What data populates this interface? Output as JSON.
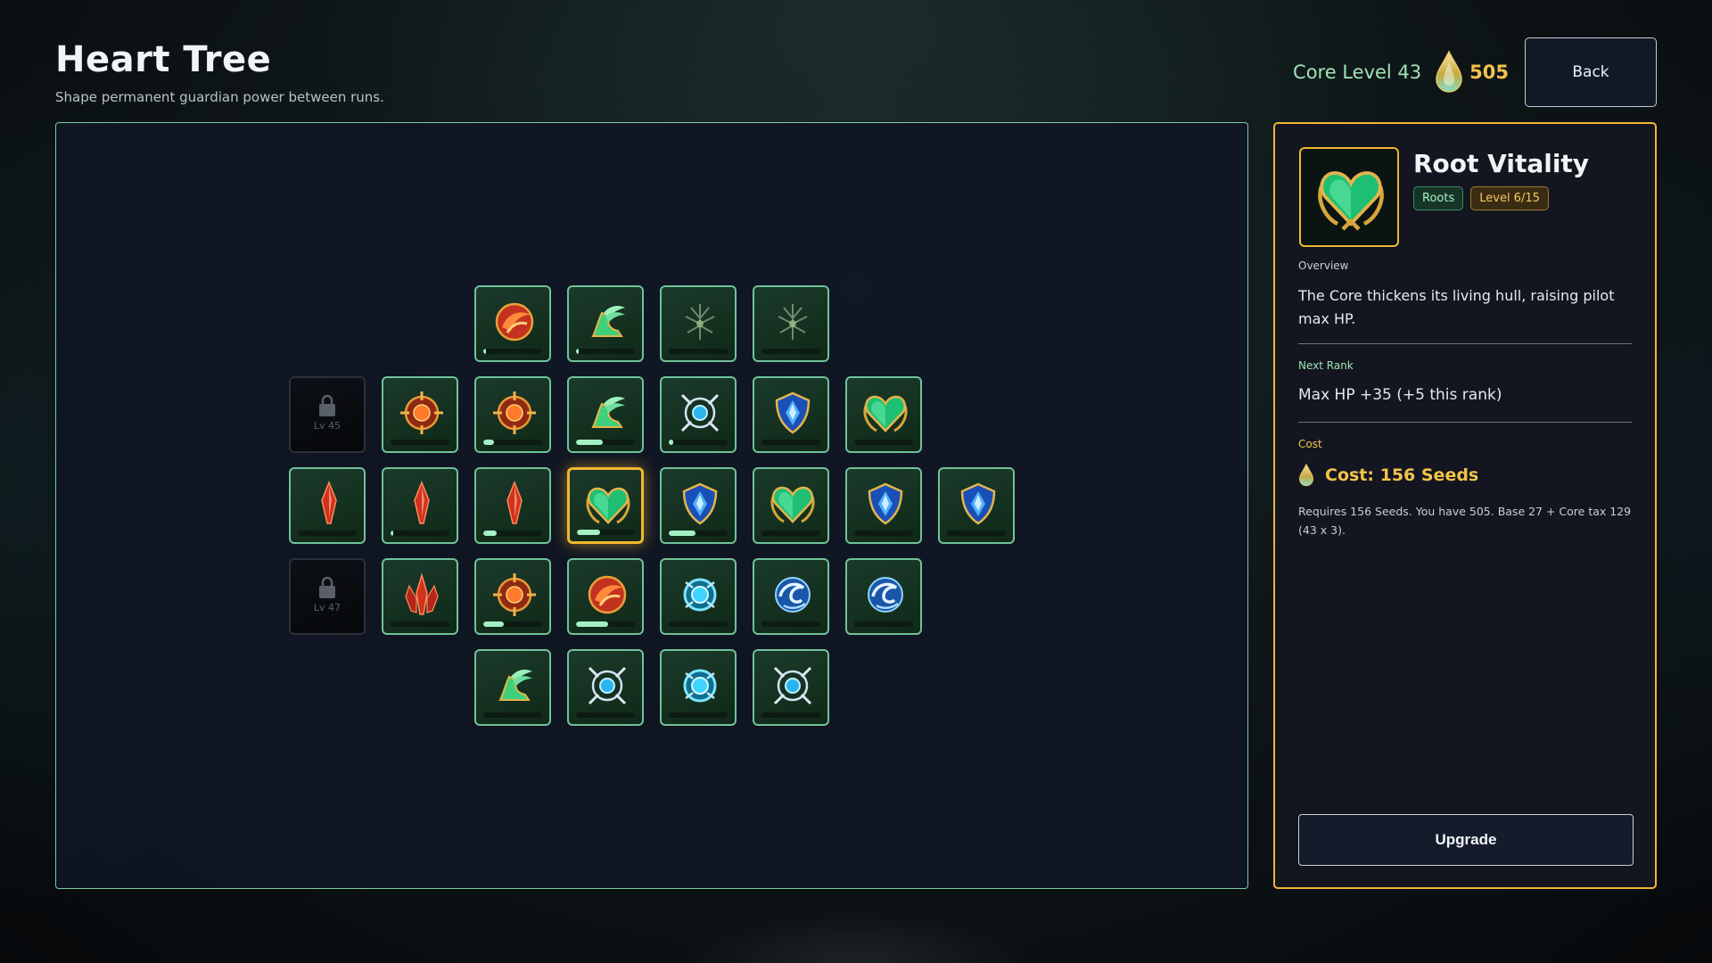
{
  "header": {
    "title": "Heart Tree",
    "subtitle": "Shape permanent guardian power between runs."
  },
  "top_bar": {
    "core_level": "Core Level 43",
    "seeds": "505",
    "back_label": "Back"
  },
  "colors": {
    "accent_gold": "#f0b634",
    "node_border": "#6fc29b",
    "progress": "#a3f0c4",
    "seed_gold": "#f2c34b"
  },
  "nodes": [
    {
      "id": "r0c2",
      "icon": "fire-orb-icon",
      "progress": 0.05
    },
    {
      "id": "r0c3",
      "icon": "winged-boot-icon",
      "progress": 0.05
    },
    {
      "id": "r0c4",
      "icon": "dim-thorn-sigil-icon",
      "progress": 0
    },
    {
      "id": "r0c5",
      "icon": "dim-thorn-sigil-icon",
      "progress": 0
    },
    {
      "id": "r1c0",
      "icon": "lock-icon",
      "locked": true,
      "lock_label": "Lv 45"
    },
    {
      "id": "r1c1",
      "icon": "fire-crosshair-icon",
      "progress": 0
    },
    {
      "id": "r1c2",
      "icon": "fire-crosshair-icon",
      "progress": 0.18
    },
    {
      "id": "r1c3",
      "icon": "winged-boot-icon",
      "progress": 0.45
    },
    {
      "id": "r1c4",
      "icon": "frost-crosshair-icon",
      "progress": 0.08
    },
    {
      "id": "r1c5",
      "icon": "blue-shield-icon",
      "progress": 0
    },
    {
      "id": "r1c6",
      "icon": "emerald-heart-icon",
      "progress": 0
    },
    {
      "id": "r2c0",
      "icon": "red-crystal-icon",
      "progress": 0
    },
    {
      "id": "r2c1",
      "icon": "red-crystal-icon",
      "progress": 0.05
    },
    {
      "id": "r2c2",
      "icon": "red-crystal-icon",
      "progress": 0.22
    },
    {
      "id": "r2c3",
      "icon": "emerald-heart-icon",
      "progress": 0.4,
      "selected": true
    },
    {
      "id": "r2c4",
      "icon": "blue-shield-icon",
      "progress": 0.45
    },
    {
      "id": "r2c5",
      "icon": "emerald-heart-icon",
      "progress": 0
    },
    {
      "id": "r2c6",
      "icon": "blue-shield-icon",
      "progress": 0
    },
    {
      "id": "r2c7",
      "icon": "blue-shield-icon",
      "progress": 0
    },
    {
      "id": "r3c0",
      "icon": "lock-icon",
      "locked": true,
      "lock_label": "Lv 47"
    },
    {
      "id": "r3c1",
      "icon": "red-crystal-cluster-icon",
      "progress": 0
    },
    {
      "id": "r3c2",
      "icon": "fire-crosshair-icon",
      "progress": 0.35
    },
    {
      "id": "r3c3",
      "icon": "fire-orb-icon",
      "progress": 0.55
    },
    {
      "id": "r3c4",
      "icon": "cyan-ring-icon",
      "progress": 0
    },
    {
      "id": "r3c5",
      "icon": "frost-swirl-icon",
      "progress": 0
    },
    {
      "id": "r3c6",
      "icon": "frost-swirl-icon",
      "progress": 0
    },
    {
      "id": "r4c2",
      "icon": "winged-boot-icon",
      "progress": 0
    },
    {
      "id": "r4c3",
      "icon": "frost-crosshair-icon",
      "progress": 0
    },
    {
      "id": "r4c4",
      "icon": "cyan-ring-icon",
      "progress": 0
    },
    {
      "id": "r4c5",
      "icon": "frost-crosshair-icon",
      "progress": 0
    }
  ],
  "detail": {
    "icon": "emerald-heart-icon",
    "name": "Root Vitality",
    "tag_branch": "Roots",
    "tag_level": "Level 6/15",
    "overview_label": "Overview",
    "overview_text": "The Core thickens its living hull, raising pilot max HP.",
    "next_rank_label": "Next Rank",
    "next_rank_text": "Max HP +35 (+5 this rank)",
    "cost_label": "Cost",
    "cost_text": "Cost: 156 Seeds",
    "cost_note": "Requires 156 Seeds. You have 505. Base 27 + Core tax 129 (43 x 3).",
    "upgrade_label": "Upgrade"
  }
}
